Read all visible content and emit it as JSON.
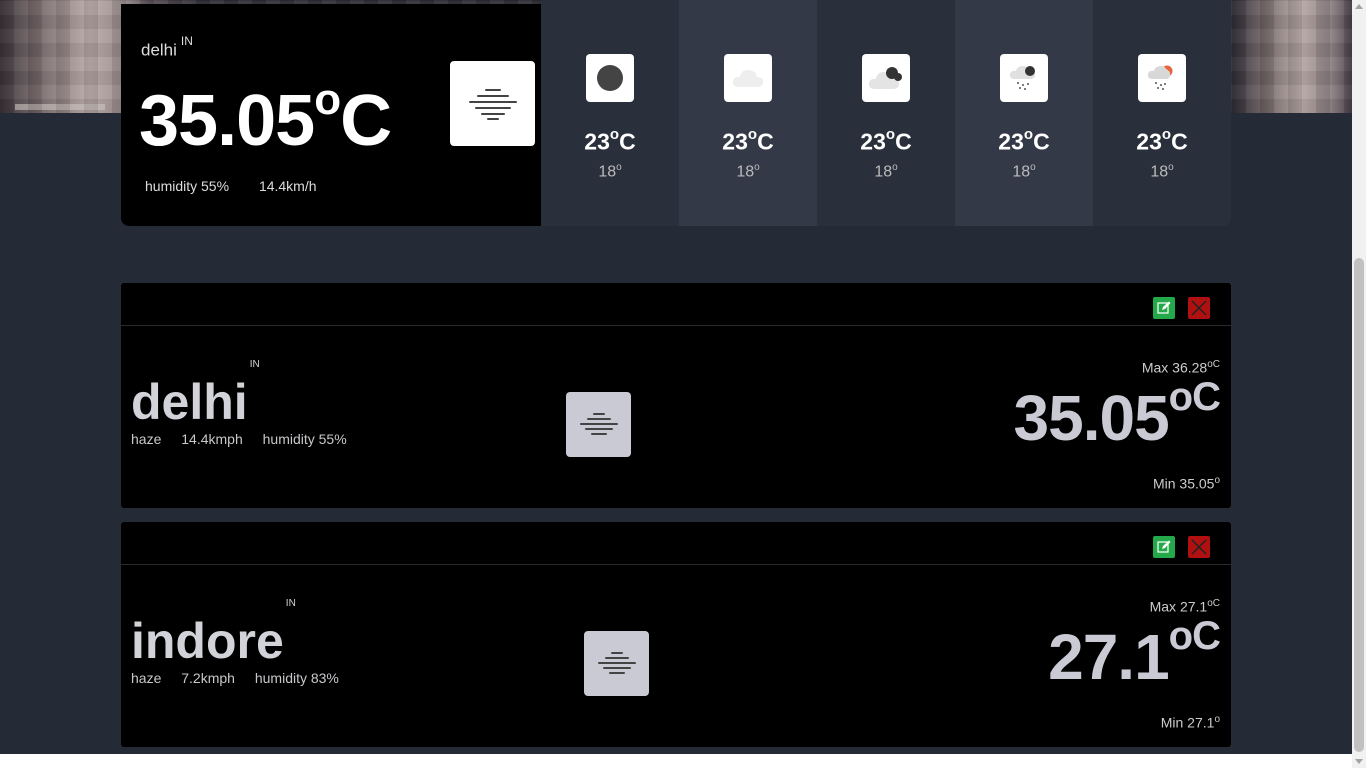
{
  "current": {
    "city": "delhi",
    "country": "IN",
    "temp": "35.05",
    "unit_sup": "o",
    "unit": "C",
    "humidity": "humidity 55%",
    "wind": "14.4km/h",
    "icon": "haze-icon"
  },
  "forecast": [
    {
      "max": "23",
      "max_sup": "o",
      "unit": "C",
      "min": "18",
      "min_sup": "o",
      "icon": "clear-night-icon"
    },
    {
      "max": "23",
      "max_sup": "o",
      "unit": "C",
      "min": "18",
      "min_sup": "o",
      "icon": "cloud-icon"
    },
    {
      "max": "23",
      "max_sup": "o",
      "unit": "C",
      "min": "18",
      "min_sup": "o",
      "icon": "cloudy-night-icon"
    },
    {
      "max": "23",
      "max_sup": "o",
      "unit": "C",
      "min": "18",
      "min_sup": "o",
      "icon": "night-rain-icon"
    },
    {
      "max": "23",
      "max_sup": "o",
      "unit": "C",
      "min": "18",
      "min_sup": "o",
      "icon": "day-rain-icon"
    }
  ],
  "cards": [
    {
      "city": "delhi",
      "country": "IN",
      "condition": "haze",
      "wind": "14.4kmph",
      "humidity": "humidity 55%",
      "max_label": "Max 36.28",
      "max_sup": "oC",
      "temp": "35.05",
      "temp_sup": "oC",
      "min_label": "Min 35.05",
      "min_sup": "o",
      "icon": "haze-icon"
    },
    {
      "city": "indore",
      "country": "IN",
      "condition": "haze",
      "wind": "7.2kmph",
      "humidity": "humidity 83%",
      "max_label": "Max 27.1",
      "max_sup": "oC",
      "temp": "27.1",
      "temp_sup": "oC",
      "min_label": "Min 27.1",
      "min_sup": "o",
      "icon": "haze-icon"
    }
  ],
  "colors": {
    "page_bg": "#252a37",
    "edit": "#23a84a",
    "delete": "#b01010"
  }
}
